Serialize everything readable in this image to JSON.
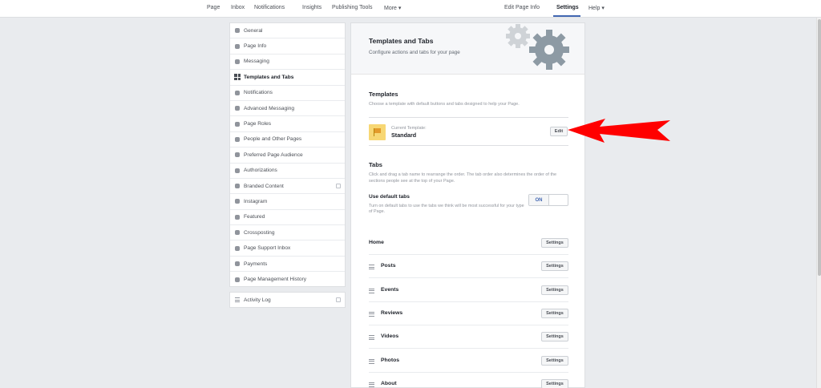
{
  "topnav": {
    "page": "Page",
    "inbox": "Inbox",
    "notifications": "Notifications",
    "insights": "Insights",
    "publishing_tools": "Publishing Tools",
    "more": "More ▾",
    "edit_page_info": "Edit Page Info",
    "settings": "Settings",
    "help": "Help ▾"
  },
  "sidebar": {
    "items": [
      {
        "label": "General",
        "icon": "gear-icon"
      },
      {
        "label": "Page Info",
        "icon": "pencil-icon"
      },
      {
        "label": "Messaging",
        "icon": "chat-icon"
      },
      {
        "label": "Templates and Tabs",
        "icon": "grid-icon",
        "active": true
      },
      {
        "label": "Notifications",
        "icon": "globe-icon"
      },
      {
        "label": "Advanced Messaging",
        "icon": "messenger-icon"
      },
      {
        "label": "Page Roles",
        "icon": "person-icon"
      },
      {
        "label": "People and Other Pages",
        "icon": "people-icon"
      },
      {
        "label": "Preferred Page Audience",
        "icon": "audience-icon"
      },
      {
        "label": "Authorizations",
        "icon": "wrench-icon"
      },
      {
        "label": "Branded Content",
        "icon": "handshake-icon"
      },
      {
        "label": "Instagram",
        "icon": "instagram-icon"
      },
      {
        "label": "Featured",
        "icon": "star-icon"
      },
      {
        "label": "Crossposting",
        "icon": "video-icon"
      },
      {
        "label": "Page Support Inbox",
        "icon": "facebook-icon"
      },
      {
        "label": "Payments",
        "icon": "dollar-icon"
      },
      {
        "label": "Page Management History",
        "icon": "history-icon"
      }
    ],
    "activity_log": "Activity Log"
  },
  "main": {
    "title": "Templates and Tabs",
    "subtitle": "Configure actions and tabs for your page",
    "templates_title": "Templates",
    "templates_desc": "Choose a template with default buttons and tabs designed to help your Page.",
    "current_template_label": "Current Template:",
    "current_template_value": "Standard",
    "edit_label": "Edit",
    "tabs_title": "Tabs",
    "tabs_desc": "Click and drag a tab name to rearrange the order. The tab order also determines the order of the sections people see at the top of your Page.",
    "use_default_label": "Use default tabs",
    "use_default_desc": "Turn on default tabs to use the tabs we think will be most successful for your type of Page.",
    "toggle_on": "ON",
    "settings_label": "Settings",
    "tabs": [
      {
        "name": "Home",
        "draggable": false
      },
      {
        "name": "Posts",
        "draggable": true
      },
      {
        "name": "Events",
        "draggable": true
      },
      {
        "name": "Reviews",
        "draggable": true
      },
      {
        "name": "Videos",
        "draggable": true
      },
      {
        "name": "Photos",
        "draggable": true
      },
      {
        "name": "About",
        "draggable": true
      }
    ]
  },
  "colors": {
    "accent": "#4267b2",
    "arrow": "#ff0000",
    "template_icon": "#f7d774"
  }
}
